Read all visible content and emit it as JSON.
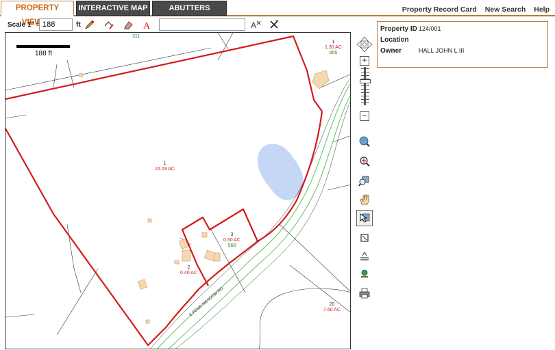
{
  "tabs": [
    {
      "label": "PROPERTY VIEWER",
      "active": true
    },
    {
      "label": "INTERACTIVE MAP",
      "active": false
    },
    {
      "label": "ABUTTERS",
      "active": false
    }
  ],
  "top_links": {
    "record_card": "Property Record Card",
    "new_search": "New Search",
    "help": "Help"
  },
  "toolbar": {
    "scale_label": "Scale 1\" =",
    "scale_value": "188",
    "scale_unit": "ft",
    "search_value": ""
  },
  "map": {
    "scalebar_label": "188 ft",
    "parcels": [
      {
        "num": "1",
        "area": "1.30 AC",
        "code": "855"
      },
      {
        "num": "1",
        "area": "16.03 AC",
        "code": ""
      },
      {
        "num": "3",
        "area": "0.50 AC",
        "code": "568"
      },
      {
        "num": "2",
        "area": "0.40 AC",
        "code": ""
      },
      {
        "num": "20",
        "area": "7.60 AC",
        "code": ""
      }
    ],
    "top_code": "311",
    "road_label": "E POND MEADOW RD"
  },
  "info": {
    "property_id_label": "Property ID",
    "property_id": "124/001",
    "location_label": "Location",
    "location": "",
    "owner_label": "Owner",
    "owner": "HALL JOHN L III"
  },
  "colors": {
    "accent": "#c8691e",
    "parcel_line": "#d21a1a",
    "road": "#5ec35e",
    "pond": "#c6d6f5"
  },
  "icons": [
    "pencil-icon",
    "measure-icon",
    "eraser-icon",
    "text-icon",
    "label-tool-icon",
    "clear-icon",
    "pan-arrows-icon",
    "zoom-in-icon",
    "zoom-out-icon",
    "globe-zoom-icon",
    "magnify-icon",
    "zoom-extent-icon",
    "hand-pan-icon",
    "select-icon",
    "identify-icon",
    "print-setup-icon",
    "marker-icon",
    "printer-icon"
  ]
}
